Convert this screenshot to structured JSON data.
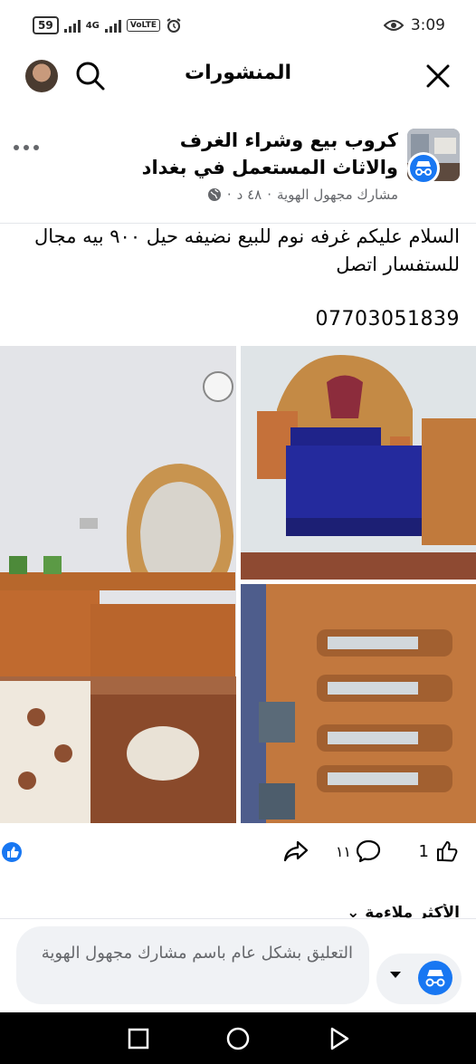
{
  "status_bar": {
    "battery": "59",
    "network": "4G",
    "volte": "VoLTE",
    "time": "3:09"
  },
  "header": {
    "title": "المنشورات"
  },
  "post": {
    "group_name": "كروب بيع وشراء الغرف والاثاث المستعمل في بغداد",
    "author": "مشارك مجهول الهوية",
    "time_ago": "٤٨ د",
    "body": "السلام عليكم غرفه نوم للبيع نضيفه  حيل ٩٠٠ بيه مجال للستفسار اتصل",
    "phone": "07703051839",
    "like_count": "1",
    "comment_count": "١١"
  },
  "comments": {
    "sort_label": "الأكثر ملاءمة ⌄"
  },
  "comment_bar": {
    "placeholder": "التعليق بشكل عام باسم مشارك مجهول الهوية"
  },
  "colors": {
    "accent": "#1877f2",
    "secondary_text": "#65676b",
    "input_bg": "#f0f2f5"
  },
  "icons": [
    "search-icon",
    "close-icon",
    "more-icon",
    "globe-icon",
    "anonymous-icon",
    "like-icon",
    "comment-icon",
    "share-icon",
    "chevron-down-icon",
    "recent-apps-icon",
    "home-icon",
    "back-icon"
  ]
}
